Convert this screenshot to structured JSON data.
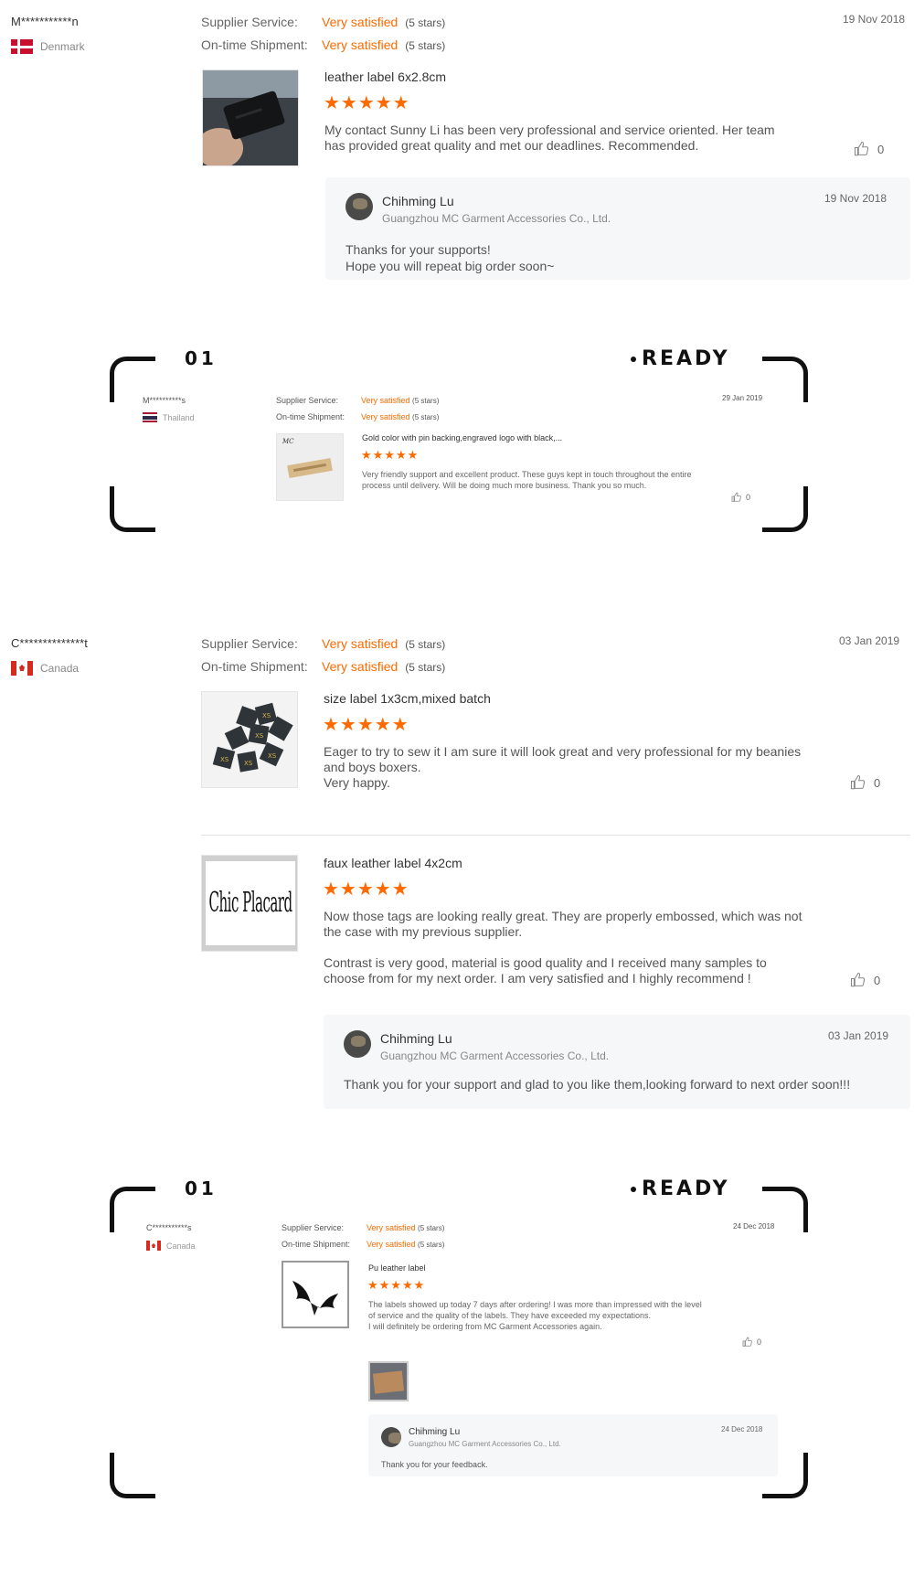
{
  "review1": {
    "reviewer": "M***********n",
    "country": "Denmark",
    "supplier_service_label": "Supplier Service:",
    "supplier_service_value": "Very satisfied",
    "supplier_service_stars": "(5 stars)",
    "shipment_label": "On-time Shipment:",
    "shipment_value": "Very satisfied",
    "shipment_stars": "(5 stars)",
    "date": "19 Nov 2018",
    "product_title": "leather label 6x2.8cm",
    "stars": "★★★★★",
    "text": "My contact Sunny Li has been very professional and service oriented. Her team has provided great quality and met our deadlines. Recommended.",
    "likes": "0",
    "reply": {
      "name": "Chihming Lu",
      "company": "Guangzhou MC Garment Accessories Co., Ltd.",
      "date": "19 Nov 2018",
      "text": "Thanks for your supports!\nHope you will repeat big order soon~"
    }
  },
  "frame1": {
    "label_left": "01",
    "label_right": "READY",
    "reviewer": "M**********s",
    "country": "Thailand",
    "supplier_service_label": "Supplier Service:",
    "supplier_service_value": "Very satisfied",
    "supplier_service_stars": "(5 stars)",
    "shipment_label": "On-time Shipment:",
    "shipment_value": "Very satisfied",
    "shipment_stars": "(5 stars)",
    "date": "29 Jan 2019",
    "product_title": "Gold color with pin backing,engraved logo with black,...",
    "stars": "★★★★★",
    "text": "Very friendly support and excellent product. These guys kept in touch throughout the entire process until delivery. Will be doing much more business. Thank you so much.",
    "likes": "0"
  },
  "review2": {
    "reviewer": "C**************t",
    "country": "Canada",
    "supplier_service_label": "Supplier Service:",
    "supplier_service_value": "Very satisfied",
    "supplier_service_stars": "(5 stars)",
    "shipment_label": "On-time Shipment:",
    "shipment_value": "Very satisfied",
    "shipment_stars": "(5 stars)",
    "date": "03 Jan 2019",
    "item1": {
      "product_title": "size label 1x3cm,mixed batch",
      "stars": "★★★★★",
      "text": "Eager to try to sew it I am sure it will look great and very professional for my beanies and boys boxers.\nVery happy.",
      "likes": "0"
    },
    "item2": {
      "product_title": "faux leather label 4x2cm",
      "stars": "★★★★★",
      "image_text": "Chic Placard",
      "text": "Now those tags are looking really great.  They are properly embossed, which was not the case with my previous supplier.\n\nContrast is very good, material is good quality and I received many samples to choose from for my next order.  I am very satisfied and I highly recommend !",
      "likes": "0"
    },
    "reply": {
      "name": "Chihming Lu",
      "company": "Guangzhou MC Garment Accessories Co., Ltd.",
      "date": "03 Jan 2019",
      "text": "Thank you for your support and glad to you like them,looking forward to next order soon!!!"
    }
  },
  "frame2": {
    "label_left": "01",
    "label_right": "READY",
    "reviewer": "C***********s",
    "country": "Canada",
    "supplier_service_label": "Supplier Service:",
    "supplier_service_value": "Very satisfied",
    "supplier_service_stars": "(5 stars)",
    "shipment_label": "On-time Shipment:",
    "shipment_value": "Very satisfied",
    "shipment_stars": "(5 stars)",
    "date": "24 Dec 2018",
    "product_title": "Pu leather label",
    "stars": "★★★★★",
    "text": "The labels showed up today 7 days after ordering! I was more than impressed with the level of service and the quality of the labels. They have exceeded my expectations.\nI will definitely be ordering from MC Garment Accessories again.",
    "likes": "0",
    "reply": {
      "name": "Chihming Lu",
      "company": "Guangzhou MC Garment Accessories Co., Ltd.",
      "date": "24 Dec 2018",
      "text": "Thank you for your feedback."
    }
  },
  "colors": {
    "accent": "#ff6a00",
    "reply_bg": "#f6f7f9"
  },
  "icons": [
    "thumbs-up-icon",
    "flag-denmark-icon",
    "flag-canada-icon",
    "flag-thailand-icon",
    "star-icon"
  ]
}
